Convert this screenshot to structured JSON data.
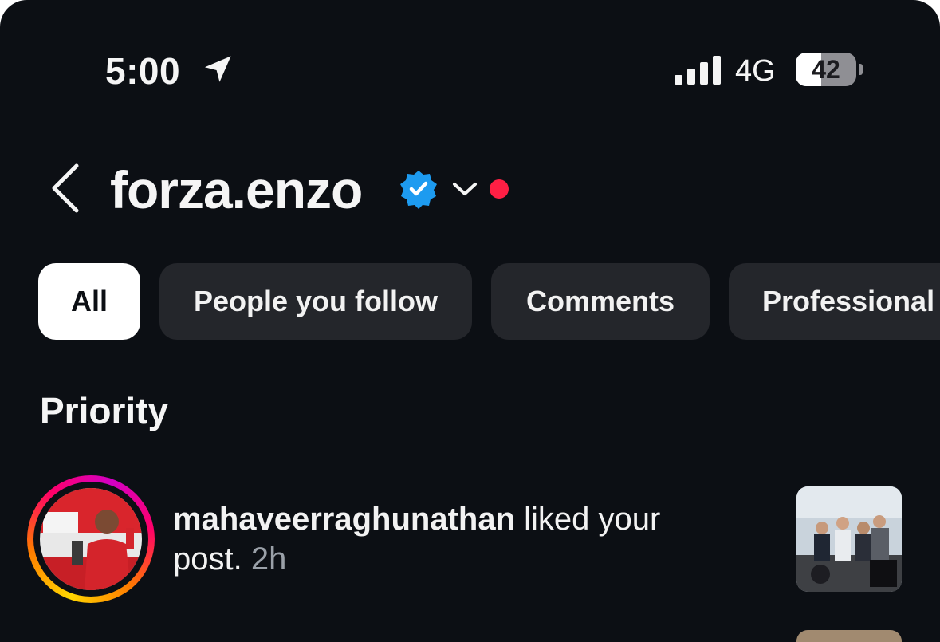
{
  "status_bar": {
    "time": "5:00",
    "network": "4G",
    "battery_level": "42",
    "battery_fraction": 0.42,
    "location_icon": "location-arrow-icon",
    "signal_icon": "cellular-signal-icon"
  },
  "header": {
    "back_icon": "chevron-left-icon",
    "username": "forza.enzo",
    "verified_icon": "verified-badge-icon",
    "account_switch_icon": "chevron-down-icon",
    "notification_dot_color": "#ff1f44"
  },
  "filters": {
    "all": "All",
    "people_you_follow": "People you follow",
    "comments": "Comments",
    "professional": "Professional"
  },
  "section": {
    "title": "Priority"
  },
  "notification": {
    "username": "mahaveerraghunathan",
    "action": " liked your post. ",
    "time": "2h"
  },
  "colors": {
    "background": "#0c0f14",
    "chip": "#24262b",
    "chip_active": "#ffffff",
    "verified": "#1d9bf0"
  }
}
